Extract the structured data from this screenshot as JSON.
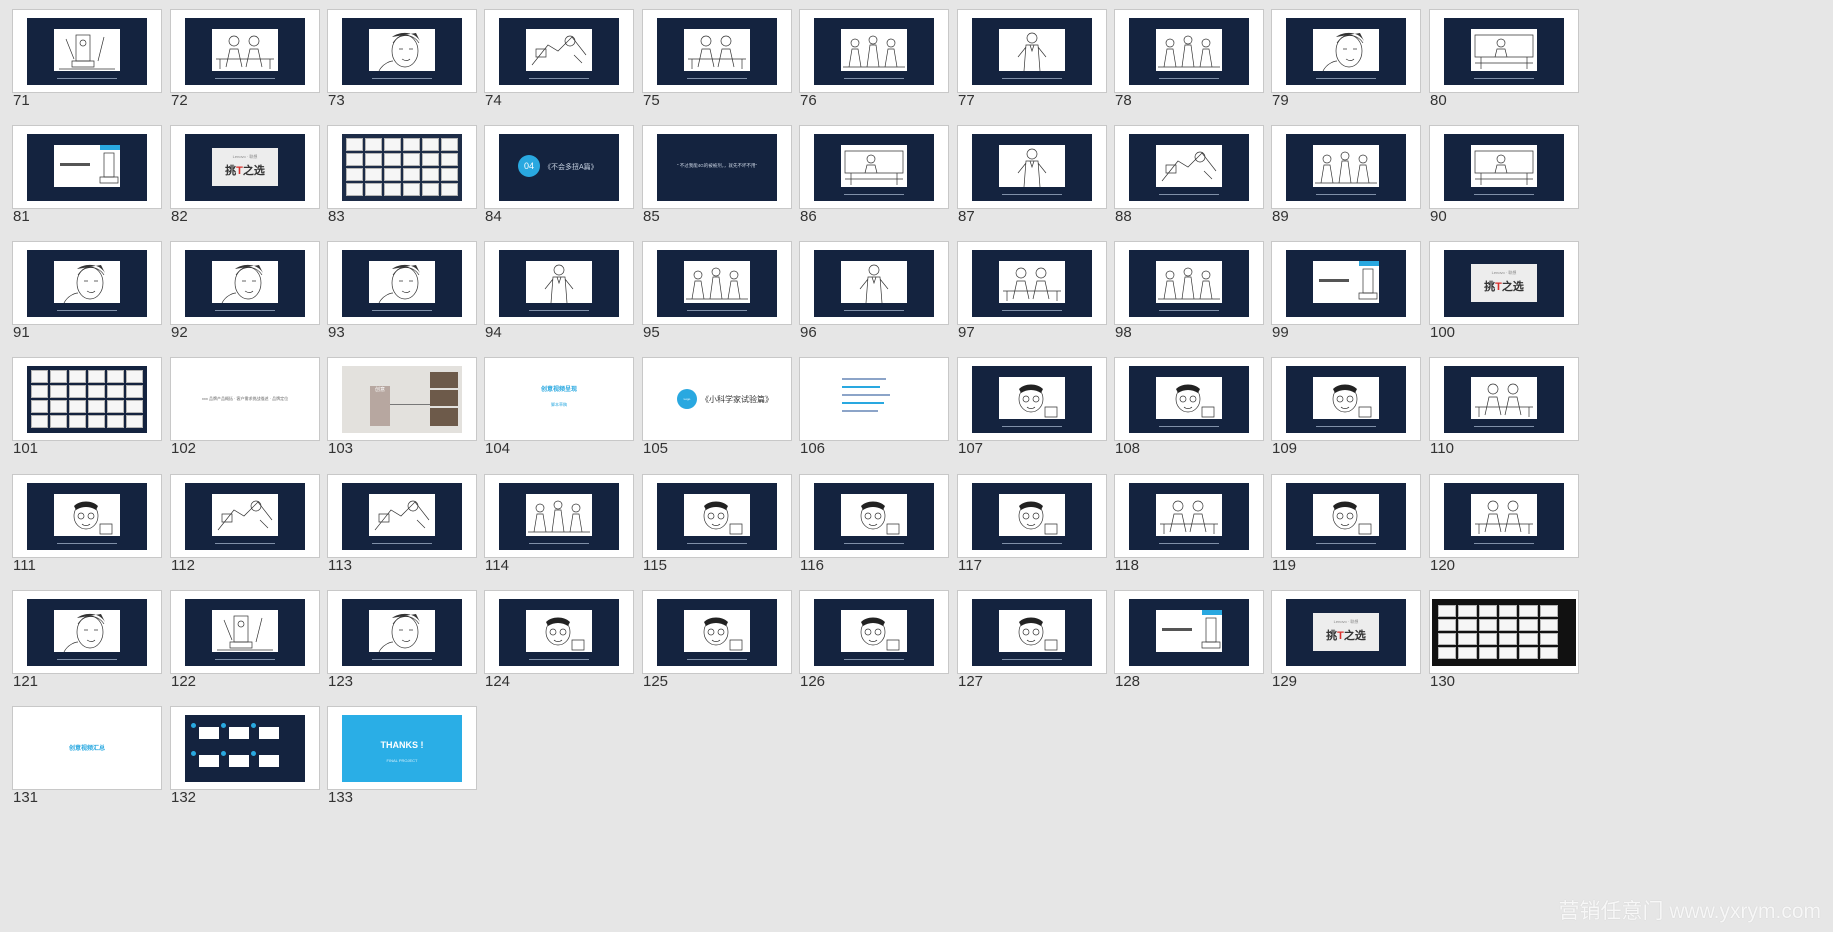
{
  "watermark": "营销任意门 www.yxrym.com",
  "colors": {
    "background": "#e6e6e6",
    "slide_bg": "#ffffff",
    "navy_panel": "#14233f",
    "accent_blue": "#29a8e0",
    "accent_red": "#d9302c"
  },
  "texts": {
    "brand_small": "Lenovo · 联想",
    "title_card_left": "挑",
    "title_card_t": "T",
    "title_card_right": "之选",
    "section_04_badge": "04",
    "section_04_text": "《不会多扭A篇》",
    "quote_85": "“ 不过我能4G的被被剂，，就先不坏不用”",
    "slide102_text": "xxx 品牌产品概括 · 客户需求挑战描述 · 品牌定位",
    "slide104_title": "创意视频呈现",
    "slide104_sub": "脚本草稿",
    "slide105_badge": "Logo",
    "slide105_text": "《小科学家试验篇》",
    "slide131_title": "创意视频汇总",
    "thanks_title": "THANKS !",
    "thanks_sub": "FINAL PROJECT",
    "slide103_box": "创意"
  },
  "slides": [
    {
      "num": "71",
      "kind": "sketch",
      "art": 0
    },
    {
      "num": "72",
      "kind": "sketch",
      "art": 1
    },
    {
      "num": "73",
      "kind": "sketch",
      "art": 2
    },
    {
      "num": "74",
      "kind": "sketch",
      "art": 3
    },
    {
      "num": "75",
      "kind": "sketch",
      "art": 1
    },
    {
      "num": "76",
      "kind": "sketch",
      "art": 4
    },
    {
      "num": "77",
      "kind": "sketch",
      "art": 5
    },
    {
      "num": "78",
      "kind": "sketch",
      "art": 4
    },
    {
      "num": "79",
      "kind": "sketch",
      "art": 2
    },
    {
      "num": "80",
      "kind": "sketch",
      "art": 6
    },
    {
      "num": "81",
      "kind": "product"
    },
    {
      "num": "82",
      "kind": "titlecard"
    },
    {
      "num": "83",
      "kind": "storyboard"
    },
    {
      "num": "84",
      "kind": "section"
    },
    {
      "num": "85",
      "kind": "quote"
    },
    {
      "num": "86",
      "kind": "sketch",
      "art": 6
    },
    {
      "num": "87",
      "kind": "sketch",
      "art": 5
    },
    {
      "num": "88",
      "kind": "sketch",
      "art": 3
    },
    {
      "num": "89",
      "kind": "sketch",
      "art": 4
    },
    {
      "num": "90",
      "kind": "sketch",
      "art": 6
    },
    {
      "num": "91",
      "kind": "sketch",
      "art": 2
    },
    {
      "num": "92",
      "kind": "sketch",
      "art": 2
    },
    {
      "num": "93",
      "kind": "sketch",
      "art": 2
    },
    {
      "num": "94",
      "kind": "sketch",
      "art": 5
    },
    {
      "num": "95",
      "kind": "sketch",
      "art": 4
    },
    {
      "num": "96",
      "kind": "sketch",
      "art": 5
    },
    {
      "num": "97",
      "kind": "sketch",
      "art": 1
    },
    {
      "num": "98",
      "kind": "sketch",
      "art": 4
    },
    {
      "num": "99",
      "kind": "product"
    },
    {
      "num": "100",
      "kind": "titlecard"
    },
    {
      "num": "101",
      "kind": "storyboard-dark"
    },
    {
      "num": "102",
      "kind": "white-text"
    },
    {
      "num": "103",
      "kind": "photo"
    },
    {
      "num": "104",
      "kind": "white-title"
    },
    {
      "num": "105",
      "kind": "white-section"
    },
    {
      "num": "106",
      "kind": "white-lines"
    },
    {
      "num": "107",
      "kind": "sketch",
      "art": 7
    },
    {
      "num": "108",
      "kind": "sketch",
      "art": 7
    },
    {
      "num": "109",
      "kind": "sketch",
      "art": 7
    },
    {
      "num": "110",
      "kind": "sketch",
      "art": 1
    },
    {
      "num": "111",
      "kind": "sketch",
      "art": 7
    },
    {
      "num": "112",
      "kind": "sketch",
      "art": 3
    },
    {
      "num": "113",
      "kind": "sketch",
      "art": 3
    },
    {
      "num": "114",
      "kind": "sketch",
      "art": 4
    },
    {
      "num": "115",
      "kind": "sketch",
      "art": 7
    },
    {
      "num": "116",
      "kind": "sketch",
      "art": 7
    },
    {
      "num": "117",
      "kind": "sketch",
      "art": 7
    },
    {
      "num": "118",
      "kind": "sketch",
      "art": 1
    },
    {
      "num": "119",
      "kind": "sketch",
      "art": 7
    },
    {
      "num": "120",
      "kind": "sketch",
      "art": 1
    },
    {
      "num": "121",
      "kind": "sketch",
      "art": 2
    },
    {
      "num": "122",
      "kind": "sketch",
      "art": 0
    },
    {
      "num": "123",
      "kind": "sketch",
      "art": 2
    },
    {
      "num": "124",
      "kind": "sketch",
      "art": 7
    },
    {
      "num": "125",
      "kind": "sketch",
      "art": 7
    },
    {
      "num": "126",
      "kind": "sketch",
      "art": 7
    },
    {
      "num": "127",
      "kind": "sketch",
      "art": 7
    },
    {
      "num": "128",
      "kind": "product"
    },
    {
      "num": "129",
      "kind": "titlecard"
    },
    {
      "num": "130",
      "kind": "storyboard-black"
    },
    {
      "num": "131",
      "kind": "white-title-only"
    },
    {
      "num": "132",
      "kind": "summary"
    },
    {
      "num": "133",
      "kind": "thanks"
    }
  ]
}
